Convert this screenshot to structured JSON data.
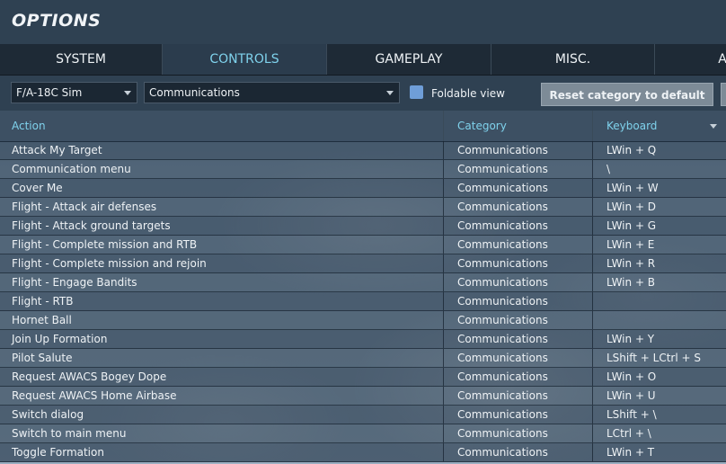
{
  "window": {
    "title": "OPTIONS"
  },
  "tabs": [
    {
      "label": "SYSTEM"
    },
    {
      "label": "CONTROLS"
    },
    {
      "label": "GAMEPLAY"
    },
    {
      "label": "MISC."
    },
    {
      "label": "A"
    }
  ],
  "active_tab": "CONTROLS",
  "filters": {
    "aircraft": "F/A-18C Sim",
    "category": "Communications",
    "foldable_label": "Foldable view",
    "foldable_checked": true,
    "reset_label": "Reset category to default"
  },
  "table": {
    "columns": [
      "Action",
      "Category",
      "Keyboard"
    ],
    "rows": [
      {
        "action": "Attack My Target",
        "category": "Communications",
        "keyboard": "LWin + Q"
      },
      {
        "action": "Communication menu",
        "category": "Communications",
        "keyboard": "\\"
      },
      {
        "action": "Cover Me",
        "category": "Communications",
        "keyboard": "LWin + W"
      },
      {
        "action": "Flight - Attack air defenses",
        "category": "Communications",
        "keyboard": "LWin + D"
      },
      {
        "action": "Flight - Attack ground targets",
        "category": "Communications",
        "keyboard": "LWin + G"
      },
      {
        "action": "Flight - Complete mission and RTB",
        "category": "Communications",
        "keyboard": "LWin + E"
      },
      {
        "action": "Flight - Complete mission and rejoin",
        "category": "Communications",
        "keyboard": "LWin + R"
      },
      {
        "action": "Flight - Engage Bandits",
        "category": "Communications",
        "keyboard": "LWin + B"
      },
      {
        "action": "Flight - RTB",
        "category": "Communications",
        "keyboard": ""
      },
      {
        "action": "Hornet Ball",
        "category": "Communications",
        "keyboard": ""
      },
      {
        "action": "Join Up Formation",
        "category": "Communications",
        "keyboard": "LWin + Y"
      },
      {
        "action": "Pilot Salute",
        "category": "Communications",
        "keyboard": "LShift + LCtrl + S"
      },
      {
        "action": "Request AWACS Bogey Dope",
        "category": "Communications",
        "keyboard": "LWin + O"
      },
      {
        "action": "Request AWACS Home Airbase",
        "category": "Communications",
        "keyboard": "LWin + U"
      },
      {
        "action": "Switch dialog",
        "category": "Communications",
        "keyboard": "LShift + \\"
      },
      {
        "action": "Switch to main menu",
        "category": "Communications",
        "keyboard": "LCtrl + \\"
      },
      {
        "action": "Toggle Formation",
        "category": "Communications",
        "keyboard": "LWin + T"
      }
    ]
  },
  "colors": {
    "accent": "#7fd2ec",
    "checkbox": "#6f9ed8",
    "header_bg": "#2f4152"
  }
}
